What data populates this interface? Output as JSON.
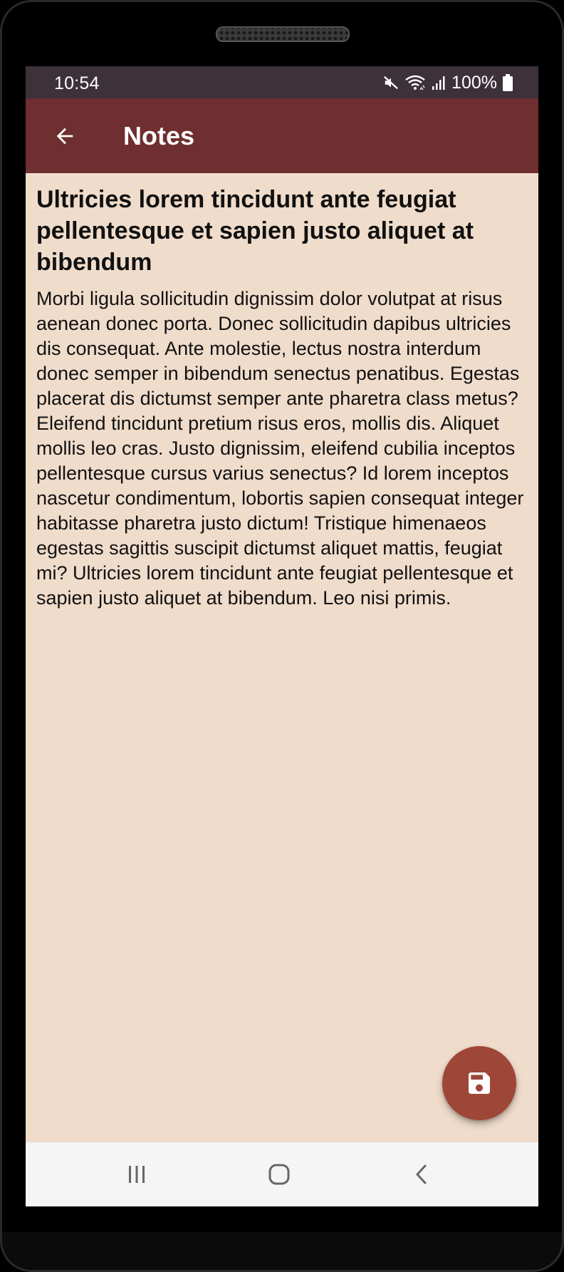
{
  "status_bar": {
    "time": "10:54",
    "battery": "100%",
    "icons": [
      "mute-icon",
      "wifi-icon",
      "signal-icon",
      "battery-icon"
    ]
  },
  "app_bar": {
    "title": "Notes",
    "back_icon": "arrow-left-icon"
  },
  "note": {
    "title": "Ultricies lorem tincidunt ante feugiat pellentesque et sapien justo aliquet at bibendum",
    "body": "Morbi ligula sollicitudin dignissim dolor volutpat at risus aenean donec porta. Donec sollicitudin dapibus ultricies dis consequat. Ante molestie, lectus nostra interdum donec semper in bibendum senectus penatibus. Egestas placerat dis dictumst semper ante pharetra class metus? Eleifend tincidunt pretium risus eros, mollis dis. Aliquet mollis leo cras. Justo dignissim, eleifend cubilia inceptos pellentesque cursus varius senectus? Id lorem inceptos nascetur condimentum, lobortis sapien consequat integer habitasse pharetra justo dictum! Tristique himenaeos egestas sagittis suscipit dictumst aliquet mattis, feugiat mi? Ultricies lorem tincidunt ante feugiat pellentesque et sapien justo aliquet at bibendum. Leo nisi primis."
  },
  "fab": {
    "icon": "save-icon"
  },
  "nav_bar": {
    "icons": [
      "recent-apps-icon",
      "home-icon",
      "back-icon"
    ]
  },
  "colors": {
    "status_bar": "#3d313a",
    "app_bar": "#6f2e2f",
    "background": "#f0dccb",
    "fab": "#9e4637",
    "nav_bar": "#f5f5f5"
  }
}
